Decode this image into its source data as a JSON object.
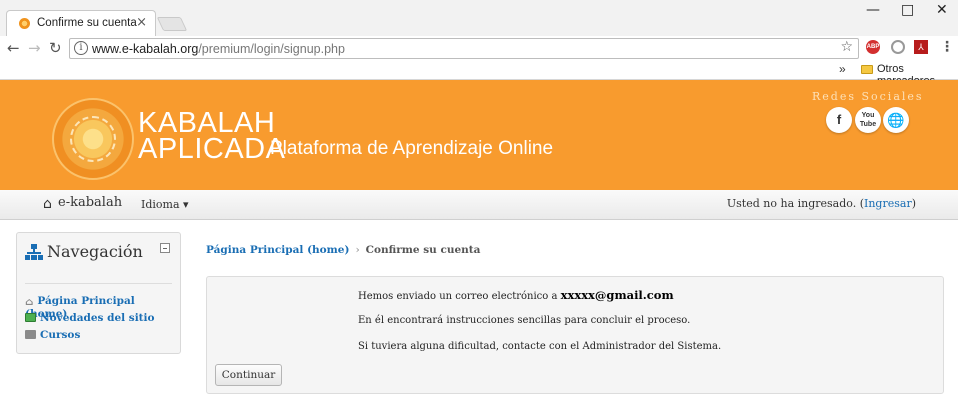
{
  "browser": {
    "tab_title": "Confirme su cuenta",
    "tab_close": "×",
    "url_host": "www.e-kabalah.org",
    "url_path": "/premium/login/signup.php",
    "bookmarks_more": "»",
    "bookmarks_folder": "Otros marcadores",
    "ext_abp": "ABP",
    "window_controls": [
      "—",
      "□",
      "✕"
    ]
  },
  "header": {
    "brand_line1": "KABALAH",
    "brand_line2": "APLICADA",
    "tagline": "Plataforma de Aprendizaje Online",
    "social_title": "Redes Sociales",
    "social_fb": "f",
    "social_yt": "You Tube",
    "social_web": "🌐"
  },
  "navbar": {
    "brand": "e-kabalah",
    "language": "Idioma ▾",
    "login_text": "Usted no ha ingresado. (",
    "login_link": "Ingresar",
    "login_close": ")"
  },
  "navigation_block": {
    "title": "Navegación",
    "items": [
      {
        "label": "Página Principal (home)",
        "icon": "home-icon"
      },
      {
        "label": "Novedades del sitio",
        "icon": "news-icon"
      },
      {
        "label": "Cursos",
        "icon": "folder-icon"
      }
    ]
  },
  "breadcrumb": {
    "home": "Página Principal (home)",
    "separator": "›",
    "current": "Confirme su cuenta"
  },
  "notice": {
    "line1_prefix": "Hemos enviado un correo electrónico a ",
    "email": "xxxxx@gmail.com",
    "line2": "En él encontrará instrucciones sencillas para concluir el proceso.",
    "line3": "Si tuviera alguna dificultad, contacte con el Administrador del Sistema.",
    "button": "Continuar"
  },
  "colors": {
    "header_orange": "#f89b2e",
    "link_blue": "#1a6eb4"
  }
}
